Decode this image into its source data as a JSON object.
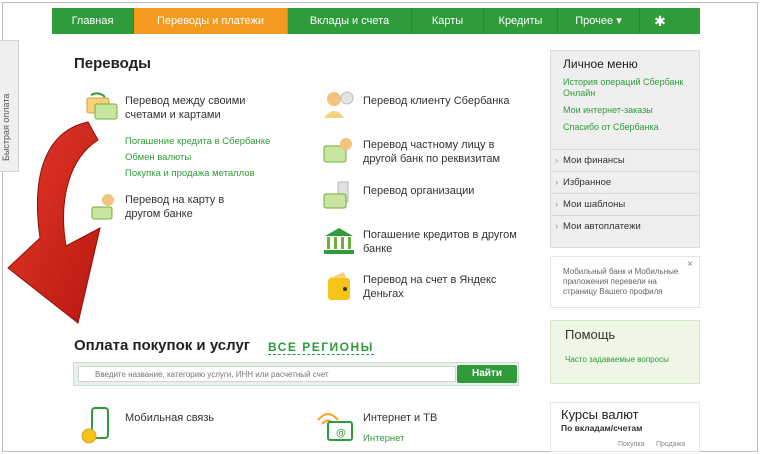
{
  "nav": {
    "items": [
      {
        "label": "Главная"
      },
      {
        "label": "Переводы и платежи"
      },
      {
        "label": "Вклады и счета"
      },
      {
        "label": "Карты"
      },
      {
        "label": "Кредиты"
      },
      {
        "label": "Прочее ▾"
      }
    ],
    "settings_icon": "gear-icon",
    "active_color": "#f39a1f",
    "bar_color": "#2f9b3a"
  },
  "side_tab": {
    "label": "Быстрая оплата"
  },
  "transfers": {
    "title": "Переводы",
    "own_accounts": {
      "label": "Перевод между своими счетами и картами",
      "links": [
        "Погашение кредита в Сбербанке",
        "Обмен валюты",
        "Покупка и продажа металлов"
      ]
    },
    "to_card": {
      "label": "Перевод на карту в другом банке"
    },
    "to_client": {
      "label": "Перевод клиенту Сбербанка"
    },
    "to_private": {
      "label": "Перевод частному лицу в другой банк по реквизитам"
    },
    "to_org": {
      "label": "Перевод организации"
    },
    "loan_other": {
      "label": "Погашение кредитов в другом банке"
    },
    "yandex": {
      "label": "Перевод на счет в Яндекс Деньгах"
    }
  },
  "payments": {
    "title": "Оплата покупок и услуг",
    "regions": "ВСЕ РЕГИОНЫ",
    "search_placeholder": "Введите название, категорию услуги, ИНН или расчетный счет",
    "search_button": "Найти",
    "mobile": {
      "label": "Мобильная связь"
    },
    "internet": {
      "label": "Интернет и ТВ",
      "link": "Интернет"
    }
  },
  "personal_menu": {
    "title": "Личное меню",
    "links": [
      "История операций Сбербанк Онлайн",
      "Мои интернет-заказы",
      "Спасибо от Сбербанка"
    ],
    "rows": [
      "Мои финансы",
      "Избранное",
      "Мои шаблоны",
      "Мои автоплатежи"
    ]
  },
  "notice": {
    "text": "Мобильный банк и Мобильные приложения перевели на страницу Вашего профиля",
    "close": "×"
  },
  "help": {
    "title": "Помощь",
    "link": "Часто задаваемые вопросы"
  },
  "rates": {
    "title": "Курсы валют",
    "subtitle": "По вкладам/счетам",
    "buy": "Покупка",
    "sell": "Продажа"
  },
  "colors": {
    "green": "#2f9b3a",
    "orange": "#f39a1f",
    "arrow_red": "#d9241c"
  }
}
